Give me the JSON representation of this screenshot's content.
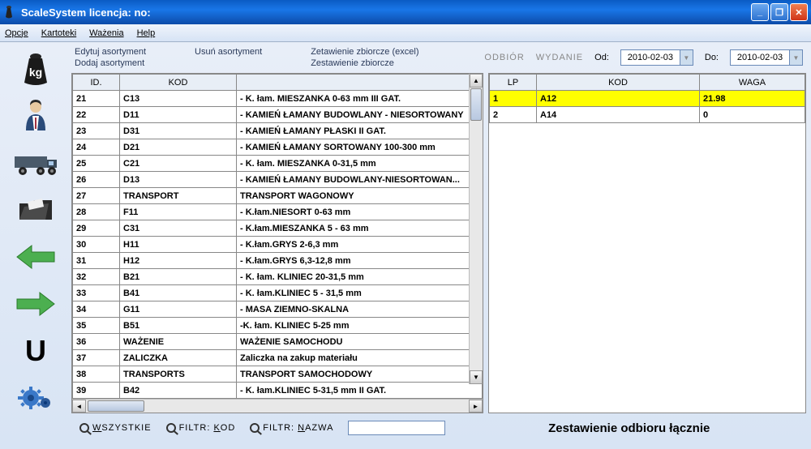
{
  "window": {
    "title": "ScaleSystem licencja:  no:"
  },
  "menu": {
    "items": [
      "Opcje",
      "Kartoteki",
      "Ważenia",
      "Help"
    ]
  },
  "toolbar": {
    "edit": "Edytuj asortyment",
    "add": "Dodaj asortyment",
    "delete": "Usuń asortyment",
    "export_excel": "Zetawienie zbiorcze (excel)",
    "summary": "Zestawienie zbiorcze"
  },
  "filters": {
    "odbior": "ODBIÓR",
    "wydanie": "WYDANIE",
    "od": "Od:",
    "do": "Do:",
    "date_from": "2010-02-03",
    "date_to": "2010-02-03"
  },
  "left_table": {
    "headers": {
      "id": "ID.",
      "kod": "KOD",
      "desc": ""
    },
    "rows": [
      {
        "id": "21",
        "kod": "C13",
        "desc": "- K. łam. MIESZANKA 0-63 mm III GAT."
      },
      {
        "id": "22",
        "kod": "D11",
        "desc": "- KAMIEŃ ŁAMANY BUDOWLANY - NIESORTOWANY"
      },
      {
        "id": "23",
        "kod": "D31",
        "desc": "- KAMIEŃ ŁAMANY PŁASKI II GAT."
      },
      {
        "id": "24",
        "kod": "D21",
        "desc": "- KAMIEŃ ŁAMANY SORTOWANY 100-300 mm"
      },
      {
        "id": "25",
        "kod": "C21",
        "desc": "- K. łam. MIESZANKA 0-31,5 mm"
      },
      {
        "id": "26",
        "kod": "D13",
        "desc": "- KAMIEŃ ŁAMANY BUDOWLANY-NIESORTOWAN..."
      },
      {
        "id": "27",
        "kod": "TRANSPORT",
        "desc": "TRANSPORT WAGONOWY"
      },
      {
        "id": "28",
        "kod": "F11",
        "desc": "- K.łam.NIESORT 0-63 mm"
      },
      {
        "id": "29",
        "kod": "C31",
        "desc": "- K.łam.MIESZANKA 5 - 63 mm"
      },
      {
        "id": "30",
        "kod": "H11",
        "desc": "- K.łam.GRYS 2-6,3 mm"
      },
      {
        "id": "31",
        "kod": "H12",
        "desc": "- K.łam.GRYS 6,3-12,8 mm"
      },
      {
        "id": "32",
        "kod": "B21",
        "desc": "- K. łam. KLINIEC 20-31,5 mm"
      },
      {
        "id": "33",
        "kod": "B41",
        "desc": "- K. łam.KLINIEC 5 - 31,5 mm"
      },
      {
        "id": "34",
        "kod": "G11",
        "desc": "- MASA ZIEMNO-SKALNA"
      },
      {
        "id": "35",
        "kod": "B51",
        "desc": "-K. łam. KLINIEC 5-25 mm"
      },
      {
        "id": "36",
        "kod": "WAŻENIE",
        "desc": "WAŻENIE SAMOCHODU"
      },
      {
        "id": "37",
        "kod": "ZALICZKA",
        "desc": "Zaliczka na zakup materiału"
      },
      {
        "id": "38",
        "kod": "TRANSPORTS",
        "desc": "TRANSPORT SAMOCHODOWY"
      },
      {
        "id": "39",
        "kod": "B42",
        "desc": "- K. łam.KLINIEC 5-31,5 mm II GAT."
      }
    ]
  },
  "right_table": {
    "headers": {
      "lp": "LP",
      "kod": "KOD",
      "waga": "WAGA"
    },
    "rows": [
      {
        "lp": "1",
        "kod": "A12",
        "waga": "21.98",
        "selected": true
      },
      {
        "lp": "2",
        "kod": "A14",
        "waga": "0",
        "selected": false
      }
    ]
  },
  "bottom": {
    "all": "WSZYSTKIE",
    "filter_kod": "FILTR: KOD",
    "filter_nazwa": "FILTR: NAZWA",
    "summary_label": "Zestawienie odbioru łącznie"
  }
}
